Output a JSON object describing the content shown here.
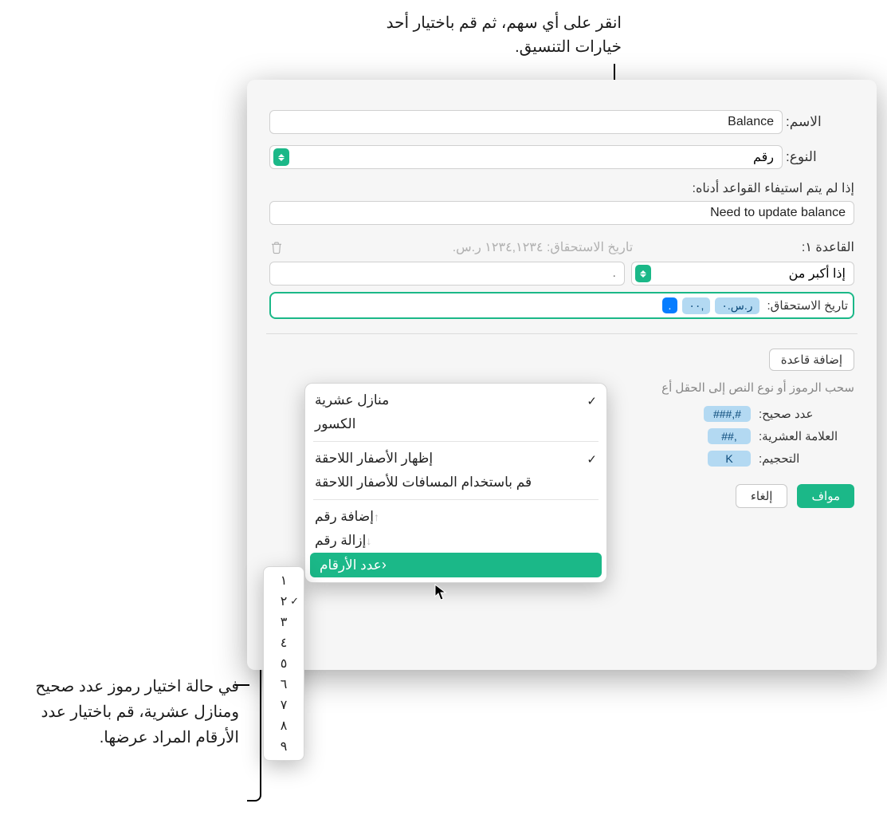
{
  "callouts": {
    "top": "انقر على أي سهم، ثم قم باختيار أحد خيارات التنسيق.",
    "bottom": "في حالة اختيار رموز عدد صحيح ومنازل عشرية، قم باختيار عدد الأرقام المراد عرضها."
  },
  "dialog": {
    "name_label": "الاسم:",
    "name_value": "Balance",
    "type_label": "النوع:",
    "type_value": "رقم",
    "norules_label": "إذا لم يتم استيفاء القواعد أدناه:",
    "norules_placeholder": "Need to update balance",
    "norules_value": "Need to update balance"
  },
  "rule": {
    "title": "القاعدة ١:",
    "preview": "تاريخ الاستحقاق: ١٢٣٤,١٢٣٤ ر.س.",
    "condition": "إذا أكبر من",
    "value_placeholder": ".",
    "format_label": "تاريخ الاستحقاق:",
    "chips": {
      "currency": "ر.س.٠",
      "fraction": ",٠٠",
      "selected": "."
    }
  },
  "buttons": {
    "add_rule": "إضافة قاعدة",
    "ok": "مواف",
    "cancel": "إلغاء"
  },
  "drag_hint": "سحب الرموز أو نوع النص إلى الحقل أع",
  "tokens": {
    "integer_label": "عدد صحيح:",
    "integer_token": "#,###",
    "decimal_label": "العلامة العشرية:",
    "decimal_token": ",##",
    "scale_label": "التحجيم:",
    "scale_token": "K"
  },
  "popup": {
    "decimal_places": "منازل عشرية",
    "fractions": "الكسور",
    "show_trailing": "إظهار الأصفار اللاحقة",
    "trailing_spaces": "قم باستخدام المسافات للأصفار اللاحقة",
    "add_digit": "إضافة رقم",
    "remove_digit": "إزالة رقم",
    "digit_count": "عدد الأرقام"
  },
  "sub_popup": {
    "items": [
      "١",
      "٢",
      "٣",
      "٤",
      "٥",
      "٦",
      "٧",
      "٨",
      "٩"
    ],
    "selected": "٢"
  }
}
